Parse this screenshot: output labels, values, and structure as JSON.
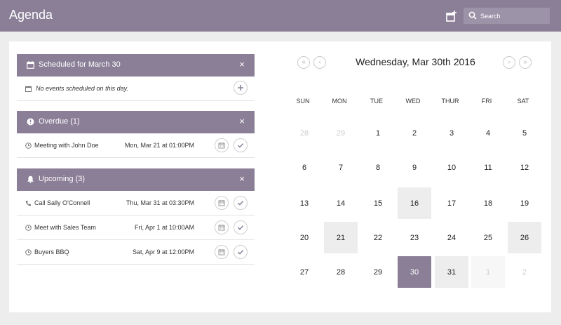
{
  "header": {
    "title": "Agenda",
    "add_icon": "calendar-plus-icon",
    "search_placeholder": "Search",
    "search_icon": "search-icon",
    "accent": "#8a7f97"
  },
  "scheduled": {
    "title": "Scheduled for March 30",
    "icon": "calendar-icon",
    "close": "×",
    "empty_text": "No events scheduled on this day."
  },
  "overdue": {
    "title": "Overdue (1)",
    "icon": "exclamation-circle-icon",
    "close": "×",
    "items": [
      {
        "icon": "clock-icon",
        "name": "Meeting with John Doe",
        "when": "Mon, Mar 21 at 01:00PM"
      }
    ]
  },
  "upcoming": {
    "title": "Upcoming (3)",
    "icon": "bell-icon",
    "close": "×",
    "items": [
      {
        "icon": "phone-icon",
        "name": "Call Sally O'Connell",
        "when": "Thu, Mar 31 at 03:30PM"
      },
      {
        "icon": "clock-icon",
        "name": "Meet with Sales Team",
        "when": "Fri, Apr 1 at 10:00AM"
      },
      {
        "icon": "clock-icon",
        "name": "Buyers BBQ",
        "when": "Sat, Apr 9 at 12:00PM"
      }
    ]
  },
  "calendar": {
    "title": "Wednesday, Mar 30th 2016",
    "nav": {
      "prev_year": "«",
      "prev_month": "‹",
      "next_month": "›",
      "next_year": "»"
    },
    "weekdays": [
      "SUN",
      "MON",
      "TUE",
      "WED",
      "THUR",
      "FRI",
      "SAT"
    ],
    "weeks": [
      [
        {
          "d": "28",
          "s": "muted"
        },
        {
          "d": "29",
          "s": "muted"
        },
        {
          "d": "1",
          "s": ""
        },
        {
          "d": "2",
          "s": ""
        },
        {
          "d": "3",
          "s": ""
        },
        {
          "d": "4",
          "s": ""
        },
        {
          "d": "5",
          "s": ""
        }
      ],
      [
        {
          "d": "6",
          "s": ""
        },
        {
          "d": "7",
          "s": ""
        },
        {
          "d": "8",
          "s": ""
        },
        {
          "d": "9",
          "s": ""
        },
        {
          "d": "10",
          "s": ""
        },
        {
          "d": "11",
          "s": ""
        },
        {
          "d": "12",
          "s": ""
        }
      ],
      [
        {
          "d": "13",
          "s": ""
        },
        {
          "d": "14",
          "s": ""
        },
        {
          "d": "15",
          "s": ""
        },
        {
          "d": "16",
          "s": "hl"
        },
        {
          "d": "17",
          "s": ""
        },
        {
          "d": "18",
          "s": ""
        },
        {
          "d": "19",
          "s": ""
        }
      ],
      [
        {
          "d": "20",
          "s": ""
        },
        {
          "d": "21",
          "s": "hl"
        },
        {
          "d": "22",
          "s": ""
        },
        {
          "d": "23",
          "s": ""
        },
        {
          "d": "24",
          "s": ""
        },
        {
          "d": "25",
          "s": ""
        },
        {
          "d": "26",
          "s": "hl"
        }
      ],
      [
        {
          "d": "27",
          "s": ""
        },
        {
          "d": "28",
          "s": ""
        },
        {
          "d": "29",
          "s": ""
        },
        {
          "d": "30",
          "s": "sel"
        },
        {
          "d": "31",
          "s": "hl"
        },
        {
          "d": "1",
          "s": "muted faint"
        },
        {
          "d": "2",
          "s": "muted"
        }
      ]
    ]
  }
}
